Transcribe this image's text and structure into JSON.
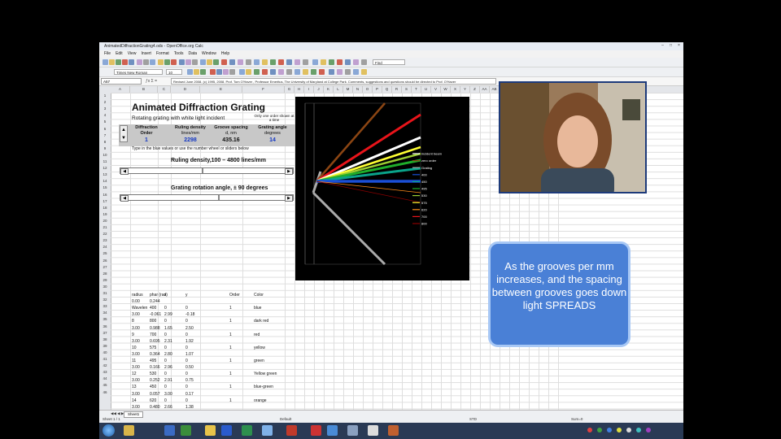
{
  "window": {
    "title": "AnimatedDiffractionGrating4.ods - OpenOffice.org Calc",
    "menu": [
      "File",
      "Edit",
      "View",
      "Insert",
      "Format",
      "Tools",
      "Data",
      "Window",
      "Help"
    ],
    "font_name": "Times New Roman",
    "font_size": "10",
    "find_placeholder": "Find",
    "cell_ref": "A57",
    "formula": "Revised June 2008. (c) 1995, 2008. Prof. Tom O'Haver , Professor Emeritus, The University of Maryland at College Park. Comments, suggestions and questions should be directed to Prof. O'Haver"
  },
  "columns": [
    "A",
    "B",
    "C",
    "D",
    "E",
    "F",
    "G",
    "H",
    "I",
    "J",
    "K",
    "L",
    "M",
    "N",
    "O",
    "P",
    "Q",
    "R",
    "S",
    "T",
    "U",
    "V",
    "W",
    "X",
    "Y",
    "Z",
    "AA",
    "AB",
    "AC",
    "AD",
    "AE",
    "AF",
    "AG",
    "AH"
  ],
  "rows": [
    "1",
    "2",
    "3",
    "4",
    "5",
    "6",
    "7",
    "8",
    "9",
    "10",
    "11",
    "12",
    "13",
    "14",
    "15",
    "16",
    "17",
    "18",
    "19",
    "20",
    "21",
    "22",
    "23",
    "24",
    "25",
    "26",
    "27",
    "28",
    "29",
    "30",
    "31",
    "32",
    "33",
    "34",
    "35",
    "36",
    "37",
    "38",
    "39",
    "40",
    "41",
    "42",
    "43",
    "44",
    "45",
    "46"
  ],
  "sheet": {
    "title": "Animated Diffraction Grating",
    "subtitle": "Rotating grating with white light incident",
    "note": "Only one order shown at a time",
    "headers": [
      {
        "l1": "Diffraction",
        "l2": "Order",
        "val": "1"
      },
      {
        "l1": "Ruling density",
        "l2": "lines/mm",
        "val": "2298"
      },
      {
        "l1": "Groove spacing",
        "l2": "d, nm",
        "val": "435.16"
      },
      {
        "l1": "Grating angle",
        "l2": "degrees",
        "val": "14"
      }
    ],
    "instructions": "Type in the blue values or use the number wheel or sliders below",
    "slider1_label": "Ruling density,100 – 4800 lines/mm",
    "slider2_label": "Grating rotation angle, ± 90 degrees",
    "slider1_value": 0.47,
    "slider2_value": 0.57,
    "table_headers": [
      "radius",
      "phar (rad)",
      "x",
      "y",
      "Order",
      "Color"
    ],
    "table": [
      [
        "0.00",
        "0.244",
        "",
        "",
        "",
        ""
      ],
      [
        "Wavelen",
        "400",
        "0",
        "0",
        "1",
        "blue"
      ],
      [
        "3.00",
        "-0.061",
        "2.99",
        "-0.18",
        "",
        ""
      ],
      [
        "8",
        "800",
        "0",
        "0",
        "1",
        "dark red"
      ],
      [
        "3.00",
        "0.988",
        "1.65",
        "2.50",
        "",
        ""
      ],
      [
        "9",
        "700",
        "0",
        "0",
        "1",
        "red"
      ],
      [
        "3.00",
        "0.695",
        "2.31",
        "1.92",
        "",
        ""
      ],
      [
        "10",
        "575",
        "0",
        "0",
        "1",
        "yellow"
      ],
      [
        "3.00",
        "0.364",
        "2.80",
        "1.07",
        "",
        ""
      ],
      [
        "11",
        "495",
        "0",
        "0",
        "1",
        "green"
      ],
      [
        "3.00",
        "0.166",
        "2.96",
        "0.50",
        "",
        ""
      ],
      [
        "12",
        "530",
        "0",
        "0",
        "1",
        "Yellow green"
      ],
      [
        "3.00",
        "0.252",
        "2.91",
        "0.75",
        "",
        ""
      ],
      [
        "13",
        "450",
        "0",
        "0",
        "1",
        "blue-green"
      ],
      [
        "3.00",
        "0.057",
        "3.00",
        "0.17",
        "",
        ""
      ],
      [
        "14",
        "620",
        "0",
        "0",
        "1",
        "orange"
      ],
      [
        "3.00",
        "0.480",
        "2.66",
        "1.38",
        "",
        ""
      ]
    ]
  },
  "chart": {
    "legend": [
      "incident beam",
      "zero order",
      "Grating",
      "400",
      "450",
      "495",
      "530",
      "575",
      "620",
      "700",
      "800"
    ],
    "colors": {
      "incident": "#ffffff",
      "zero": "#8b4513",
      "blue": "#1a4fd6",
      "bluegreen": "#0aa38a",
      "green": "#1fae2b",
      "yellowgreen": "#9acd32",
      "yellow": "#ffff33",
      "orange": "#ff8c1a",
      "red": "#e8141a",
      "darkred": "#8b0000",
      "grating": "#aaaaaa"
    }
  },
  "statusbar": {
    "sheet_position": "Sheet 1 / 1",
    "sheet_tab": "Sheet1",
    "style": "Default",
    "mode": "STD",
    "sum": "Sum=0"
  },
  "taskbar": {
    "items": [
      "start",
      "explorer",
      "word",
      "excel",
      "calc",
      "acrobat",
      "paint",
      "vlc"
    ]
  },
  "callout": {
    "text": "As the grooves per mm increases, and the spacing between grooves goes down light SPREADS"
  }
}
